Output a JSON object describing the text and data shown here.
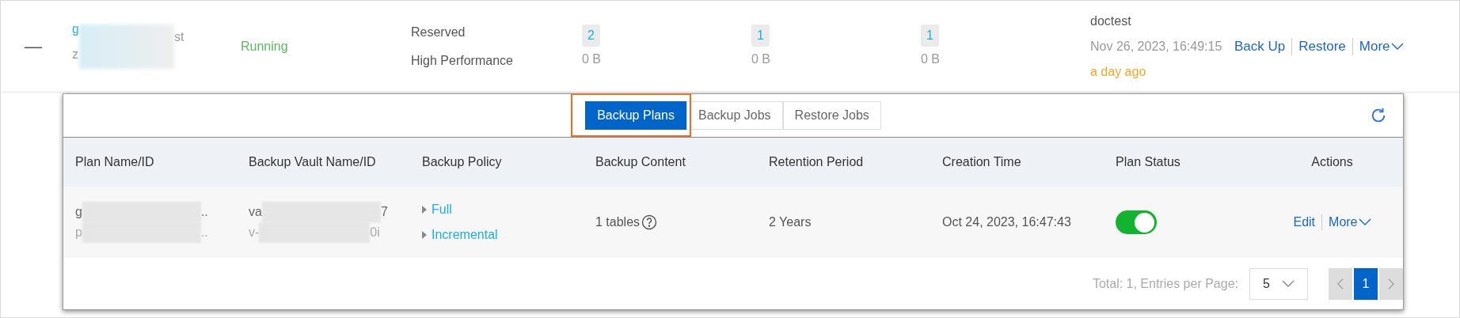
{
  "instance_row": {
    "collapse_symbol": "—",
    "name_fragments": [
      "g"
    ],
    "id_fragments": [
      "z",
      "st"
    ],
    "status": "Running",
    "spec_type": "Reserved",
    "spec_class": "High Performance",
    "counters": [
      {
        "count": "2",
        "size": "0 B"
      },
      {
        "count": "1",
        "size": "0 B"
      },
      {
        "count": "1",
        "size": "0 B"
      }
    ],
    "owner": "doctest",
    "time": "Nov 26, 2023, 16:49:15",
    "relative_time": "a day ago",
    "actions": [
      "Back Up",
      "Restore",
      "More"
    ]
  },
  "backup_panel": {
    "tabs": [
      {
        "label": "Backup Plans",
        "selected": true,
        "highlighted": true
      },
      {
        "label": "Backup Jobs",
        "selected": false,
        "highlighted": false
      },
      {
        "label": "Restore Jobs",
        "selected": false,
        "highlighted": false
      }
    ],
    "table": {
      "columns": [
        "Plan Name/ID",
        "Backup Vault Name/ID",
        "Backup Policy",
        "Backup Content",
        "Retention Period",
        "Creation Time",
        "Plan Status",
        "Actions"
      ],
      "rows": [
        {
          "plan_name": [
            "g",
            ".."
          ],
          "plan_id": [
            "p",
            ".."
          ],
          "vault_name": [
            "va",
            "7"
          ],
          "vault_id": [
            "v-",
            "0i"
          ],
          "policies": [
            "Full",
            "Incremental"
          ],
          "content": "1 tables",
          "retention": "2 Years",
          "created": "Oct 24, 2023, 16:47:43",
          "status_on": true,
          "actions": [
            "Edit",
            "More"
          ]
        }
      ]
    },
    "pagination": {
      "summary": "Total: 1, Entries per Page:",
      "page_size": "5",
      "pages": [
        {
          "label": "1",
          "selected": true
        }
      ]
    }
  }
}
